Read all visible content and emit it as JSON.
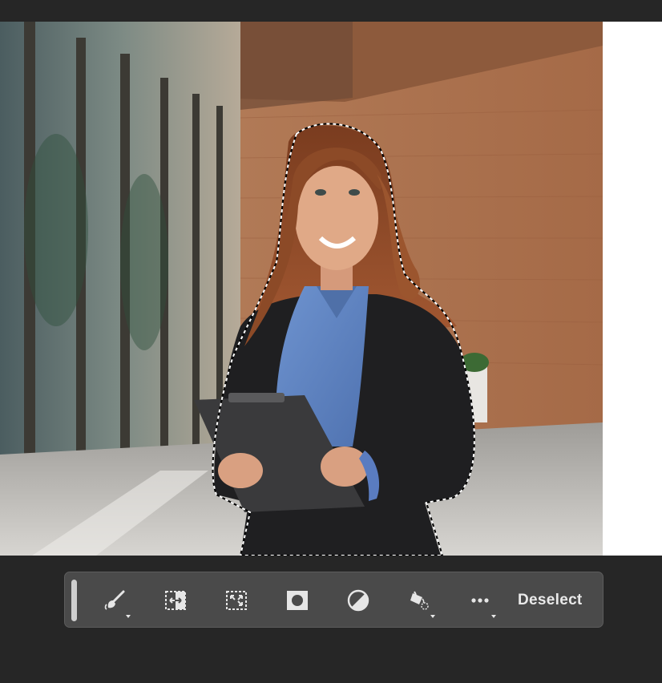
{
  "canvas": {
    "image_subject": "woman-holding-clipboard",
    "selection_state": "subject-selected"
  },
  "toolbar": {
    "tools": [
      {
        "name": "brush-refine-tool",
        "icon": "brush-icon",
        "has_dropdown": true
      },
      {
        "name": "invert-selection-tool",
        "icon": "invert-selection-icon",
        "has_dropdown": false
      },
      {
        "name": "transform-selection-tool",
        "icon": "transform-selection-icon",
        "has_dropdown": false
      },
      {
        "name": "add-mask-tool",
        "icon": "mask-icon",
        "has_dropdown": false
      },
      {
        "name": "adjustment-layer-tool",
        "icon": "adjustment-circle-icon",
        "has_dropdown": false
      },
      {
        "name": "fill-tool",
        "icon": "paint-bucket-icon",
        "has_dropdown": true
      },
      {
        "name": "more-options-tool",
        "icon": "more-dots-icon",
        "has_dropdown": true
      }
    ],
    "deselect_label": "Deselect"
  },
  "colors": {
    "app_background": "#262626",
    "toolbar_background": "#4a4a4a",
    "icon_color": "#e6e6e6",
    "selection_marquee": "#ffffff"
  }
}
